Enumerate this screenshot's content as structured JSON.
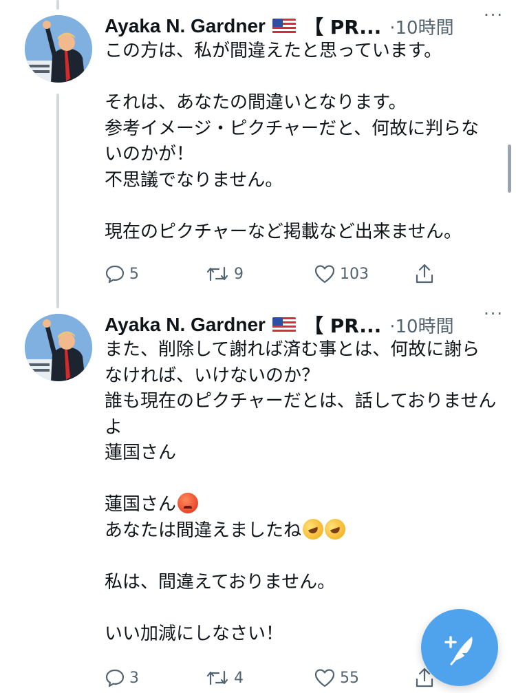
{
  "tweets": [
    {
      "author_name": "Ayaka N. Gardner",
      "name_suffix": "【 PR...",
      "time": "·10時間",
      "more": "···",
      "text": "この方は、私が間違えたと思っています。\n\nそれは、あなたの間違いとなります。\n参考イメージ・ピクチャーだと、何故に判らないのかが！\n不思議でなりません。\n\n現在のピクチャーなど掲載など出来ません。",
      "replies": "5",
      "retweets": "9",
      "likes": "103"
    },
    {
      "author_name": "Ayaka N. Gardner",
      "name_suffix": "【 PR...",
      "time": "·10時間",
      "more": "···",
      "text_a": "また、削除して謝れば済む事とは、何故に謝らなければ、いけないのか？\n誰も現在のピクチャーだとは、話しておりませんよ\n蓮国さん\n\n蓮国さん",
      "text_b": "\nあなたは間違えましたね",
      "text_c": "\n\n私は、間違えておりません。\n\nいい加減にしなさい！",
      "replies": "3",
      "retweets": "4",
      "likes": "55"
    }
  ],
  "icons": {
    "reply": "speech-bubble",
    "retweet": "retweet-arrows",
    "like": "heart",
    "share": "share-upload",
    "compose": "feather-plus",
    "emoji_angry": "angry-face",
    "emoji_rofl": "rolling-on-floor-laughing"
  },
  "colors": {
    "text": "#0f1419",
    "muted": "#536471",
    "accent": "#4fa3ed",
    "thread_line": "#cfd9de"
  }
}
